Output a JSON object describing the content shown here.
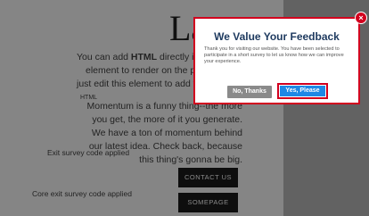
{
  "page": {
    "heading": "La",
    "paragraph1_prefix": "You can add ",
    "paragraph1_bold": "HTML",
    "paragraph1_suffix": " directly into th",
    "paragraph2": "element to render on the page.",
    "paragraph3": "just edit this element to add your",
    "paragraph3_tail": "HTML",
    "paragraph4": "Momentum is a funny thing--the more you get, the more of it you generate. We have a ton of momentum behind our latest idea. Check back, because this thing's gonna be big.",
    "exit_survey_label": "Exit survey code applied",
    "core_exit_survey_label": "Core exit survey code applied",
    "contact_button": "CONTACT US",
    "somepage_button": "SOMEPAGE"
  },
  "modal": {
    "title": "We Value Your Feedback",
    "body": "Thank you for visiting our website. You have been selected to participate in a short survey to let us know how we can improve your experience.",
    "no_button": "No, Thanks",
    "yes_button": "Yes, Please",
    "close_icon": "close-icon"
  },
  "colors": {
    "accent_red": "#d2001e",
    "yes_blue": "#1e88e5",
    "no_gray": "#8a8a8a",
    "title_navy": "#1e3a5f"
  }
}
